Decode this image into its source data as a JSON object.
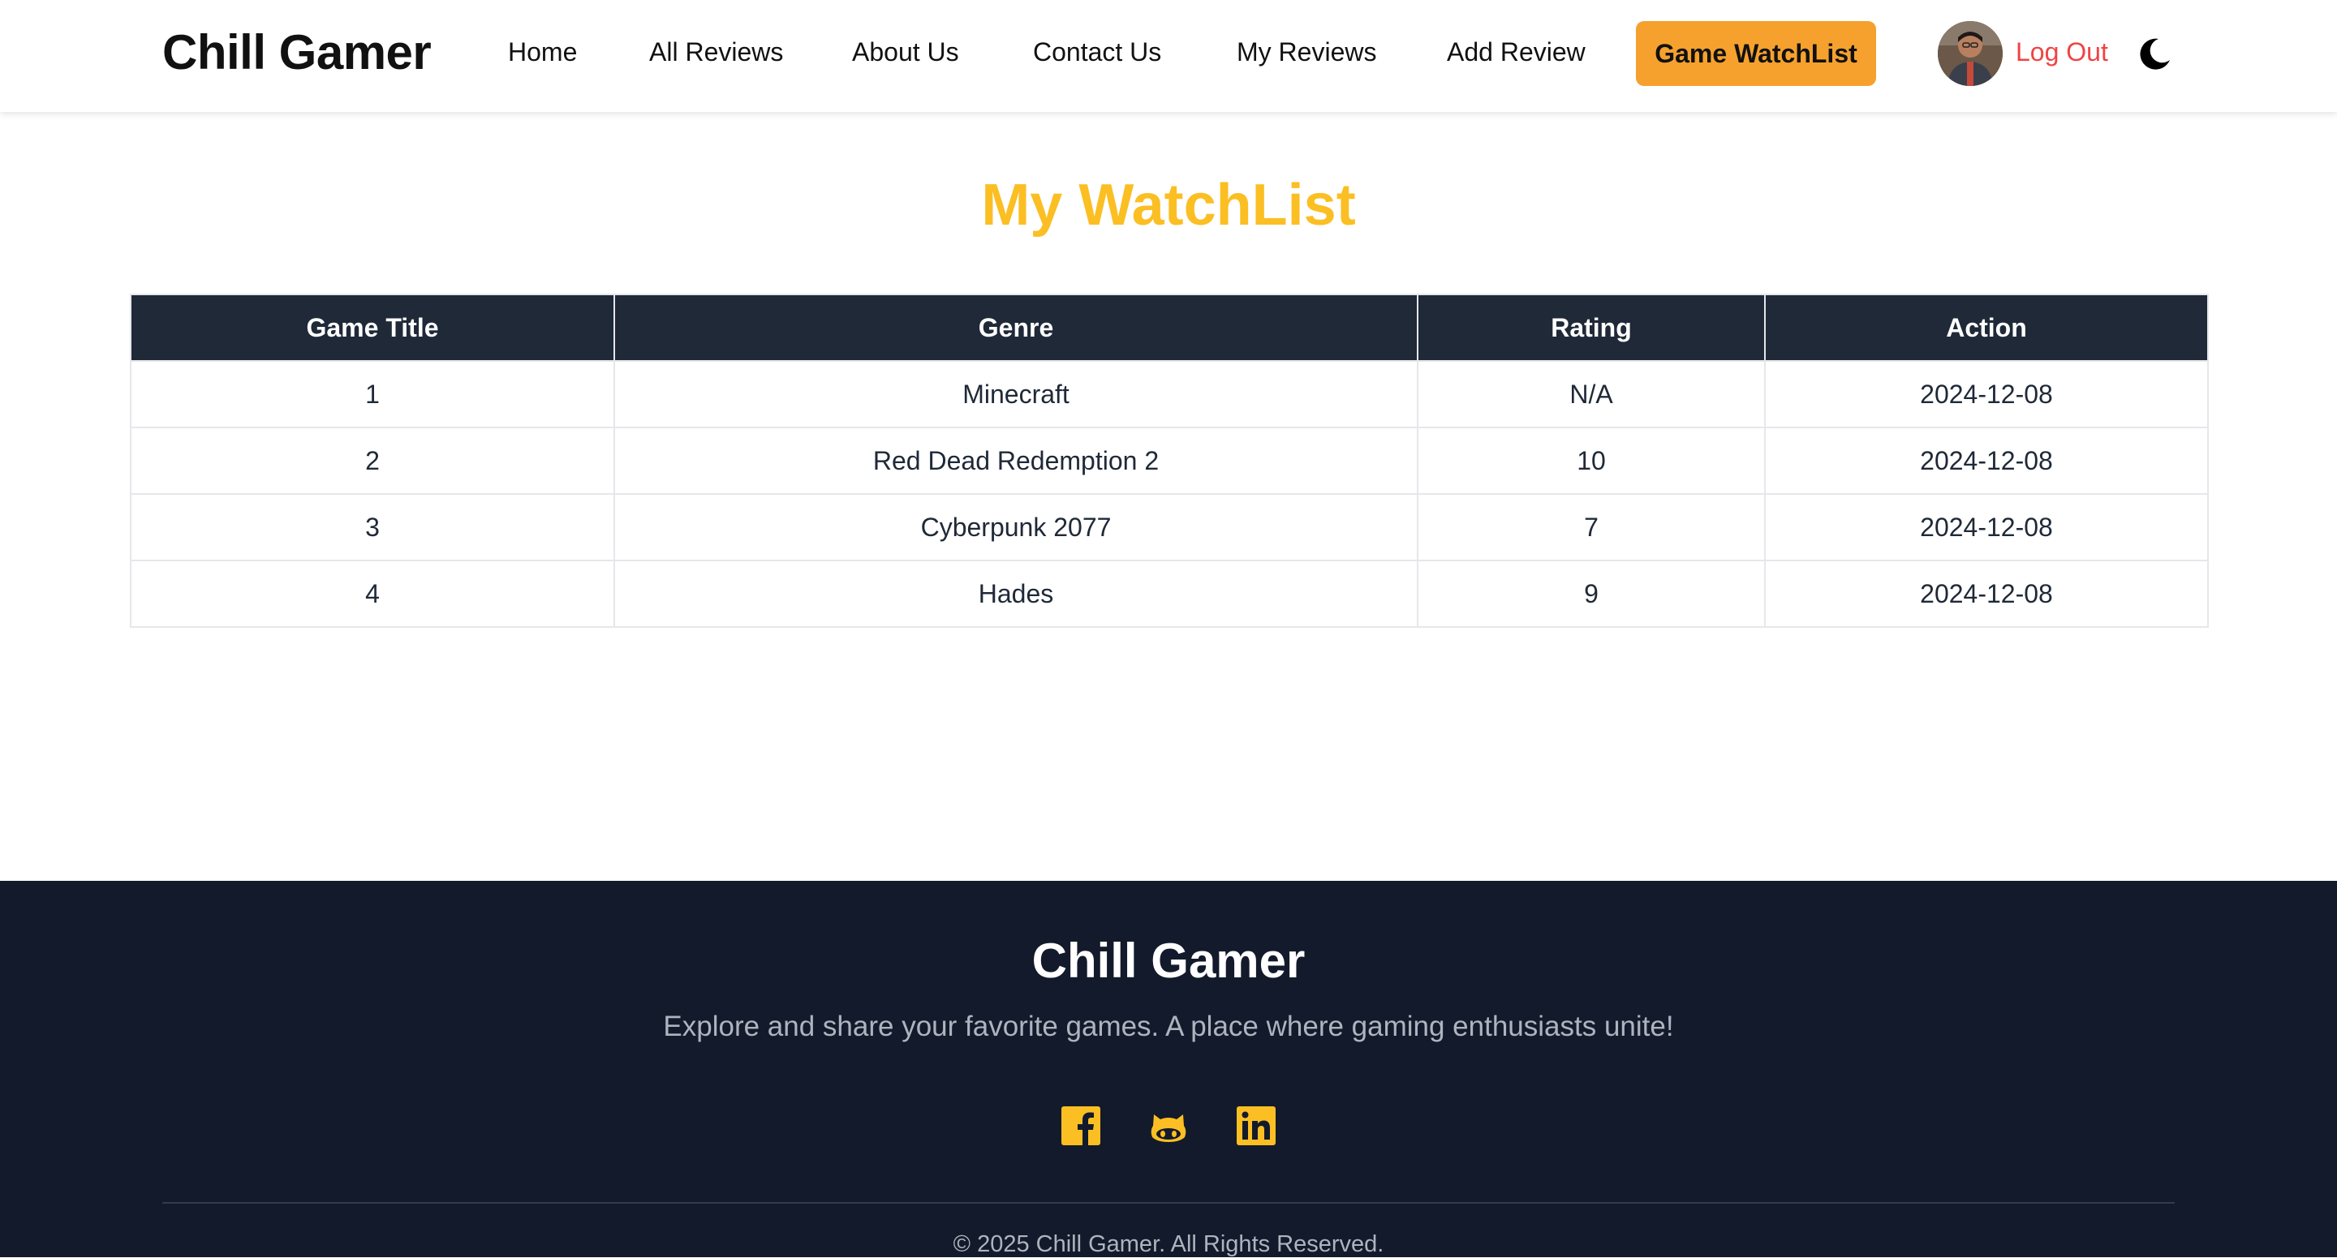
{
  "navbar": {
    "brand": "Chill Gamer",
    "links": [
      "Home",
      "All Reviews",
      "About Us",
      "Contact Us",
      "My Reviews",
      "Add Review"
    ],
    "watchlist_button": "Game WatchList",
    "logout": "Log Out",
    "avatar_icon": "user-avatar",
    "theme_icon": "moon-icon",
    "accent_color": "#f6a12e",
    "logout_color": "#ef4444"
  },
  "main": {
    "title": "My WatchList",
    "title_color": "#fbbf24",
    "table": {
      "columns": [
        "Game Title",
        "Genre",
        "Rating",
        "Action"
      ],
      "rows": [
        [
          "1",
          "Minecraft",
          "N/A",
          "2024-12-08"
        ],
        [
          "2",
          "Red Dead Redemption 2",
          "10",
          "2024-12-08"
        ],
        [
          "3",
          "Cyberpunk 2077",
          "7",
          "2024-12-08"
        ],
        [
          "4",
          "Hades",
          "9",
          "2024-12-08"
        ]
      ],
      "header_bg": "#1f2937"
    }
  },
  "footer": {
    "brand": "Chill Gamer",
    "tagline": "Explore and share your favorite games. A place where gaming enthusiasts unite!",
    "social_icons": [
      "facebook-icon",
      "github-icon",
      "linkedin-icon"
    ],
    "copyright": "© 2025 Chill Gamer. All Rights Reserved.",
    "bg_color": "#131a2b",
    "icon_color": "#fbbf24"
  }
}
